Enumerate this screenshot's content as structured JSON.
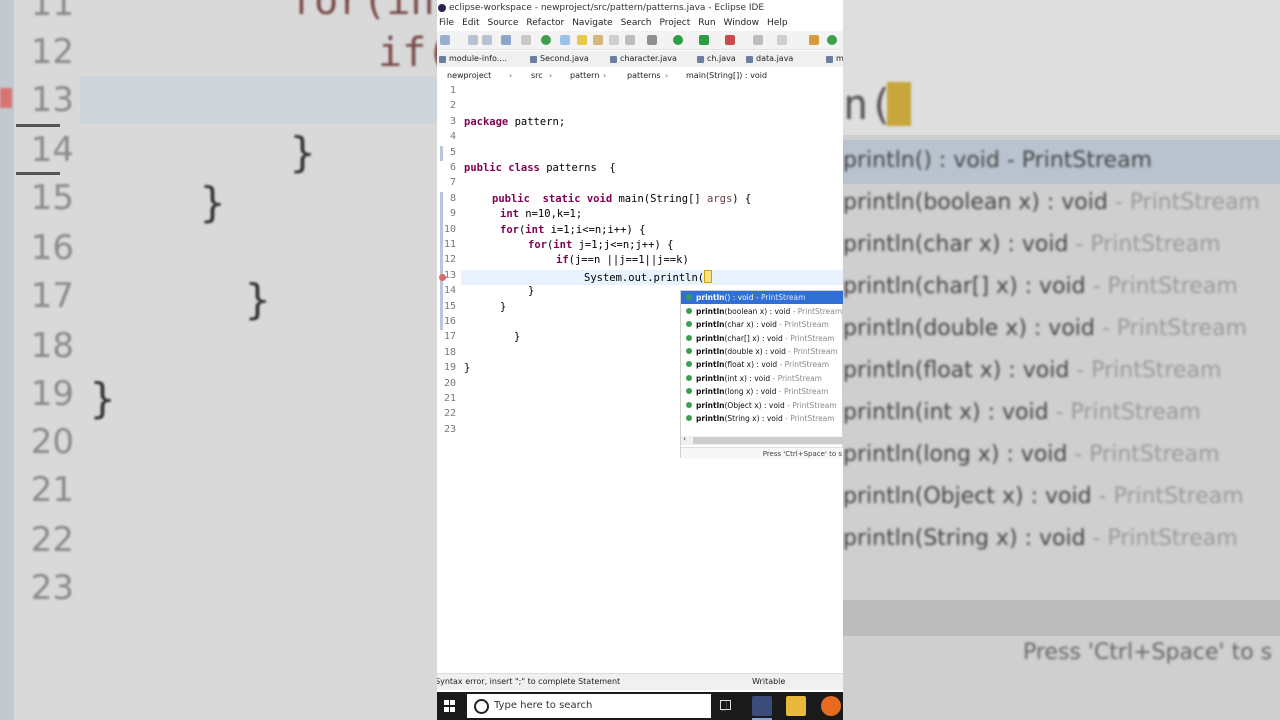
{
  "window": {
    "title": "eclipse-workspace - newproject/src/pattern/patterns.java - Eclipse IDE"
  },
  "menu": [
    "File",
    "Edit",
    "Source",
    "Refactor",
    "Navigate",
    "Search",
    "Project",
    "Run",
    "Window",
    "Help"
  ],
  "tabs": [
    "module-info....",
    "Second.java",
    "character.java",
    "ch.java",
    "data.java",
    "m"
  ],
  "breadcrumb": [
    "newproject",
    "src",
    "pattern",
    "patterns",
    "main(String[]) : void"
  ],
  "editor": {
    "line_numbers": [
      "1",
      "2",
      "3",
      "4",
      "5",
      "6",
      "7",
      "8",
      "9",
      "10",
      "11",
      "12",
      "13",
      "14",
      "15",
      "16",
      "17",
      "18",
      "19",
      "20",
      "21",
      "22",
      "23"
    ],
    "lines": {
      "l3_kw": "package",
      "l3_rest": " pattern;",
      "l6_kw1": "public",
      "l6_kw2": "class",
      "l6_rest": " patterns  {",
      "l8_kw1": "public",
      "l8_kw2": "static",
      "l8_kw3": "void",
      "l8_rest1": " main(String[] ",
      "l8_var": "args",
      "l8_rest2": ") {",
      "l9_kw": "int",
      "l9_rest": " n=10,k=1;",
      "l10_kw1": "for",
      "l10_p1": "(",
      "l10_kw2": "int",
      "l10_rest": " i=1;i<=n;i++) {",
      "l11_kw1": "for",
      "l11_p1": "(",
      "l11_kw2": "int",
      "l11_rest": " j=1;j<=n;j++) {",
      "l12_kw": "if",
      "l12_rest": "(j==n ||j==1||j==k)",
      "l13_code": "System.out.println(",
      "l14": "}",
      "l15": "}",
      "l17": "}",
      "l19": "}"
    }
  },
  "assist": {
    "proposals": [
      {
        "name": "println",
        "sig": "() : void",
        "src": " - PrintStream"
      },
      {
        "name": "println",
        "sig": "(boolean x) : void",
        "src": " - PrintStream"
      },
      {
        "name": "println",
        "sig": "(char x) : void",
        "src": " - PrintStream"
      },
      {
        "name": "println",
        "sig": "(char[] x) : void",
        "src": " - PrintStream"
      },
      {
        "name": "println",
        "sig": "(double x) : void",
        "src": " - PrintStream"
      },
      {
        "name": "println",
        "sig": "(float x) : void",
        "src": " - PrintStream"
      },
      {
        "name": "println",
        "sig": "(int x) : void",
        "src": " - PrintStream"
      },
      {
        "name": "println",
        "sig": "(long x) : void",
        "src": " - PrintStream"
      },
      {
        "name": "println",
        "sig": "(Object x) : void",
        "src": " - PrintStream"
      },
      {
        "name": "println",
        "sig": "(String x) : void",
        "src": " - PrintStream"
      }
    ],
    "hint": "Press 'Ctrl+Space' to s"
  },
  "status": {
    "message": "Syntax error, insert \";\" to complete Statement",
    "mode": "Writable"
  },
  "taskbar": {
    "search_placeholder": "Type here to search"
  },
  "background": {
    "left_numbers": [
      "11",
      "12",
      "13",
      "14",
      "15",
      "16",
      "17",
      "18",
      "19",
      "20",
      "21",
      "22",
      "23"
    ],
    "left_code_1": "for(int",
    "left_code_2": "if(",
    "left_braces": [
      "}",
      "}",
      "}",
      "}"
    ],
    "right_code": "n(",
    "right_proposals": [
      {
        "main": "println() : void - PrintStream",
        "dim": ""
      },
      {
        "main": "println(boolean x) : void",
        "dim": " - PrintStream"
      },
      {
        "main": "println(char x) : void",
        "dim": " - PrintStream"
      },
      {
        "main": "println(char[] x) : void",
        "dim": " - PrintStream"
      },
      {
        "main": "println(double x) : void",
        "dim": " - PrintStream"
      },
      {
        "main": "println(float x) : void",
        "dim": " - PrintStream"
      },
      {
        "main": "println(int x) : void",
        "dim": " - PrintStream"
      },
      {
        "main": "println(long x) : void",
        "dim": " - PrintStream"
      },
      {
        "main": "println(Object x) : void",
        "dim": " - PrintStream"
      },
      {
        "main": "println(String x) : void",
        "dim": " - PrintStream"
      }
    ],
    "right_hint": "Press 'Ctrl+Space' to s"
  },
  "colors": {
    "keyword": "#7f0055",
    "selection": "#2f6fd6",
    "current_line": "#e8f2fe",
    "taskbar": "#1a1a1a"
  }
}
